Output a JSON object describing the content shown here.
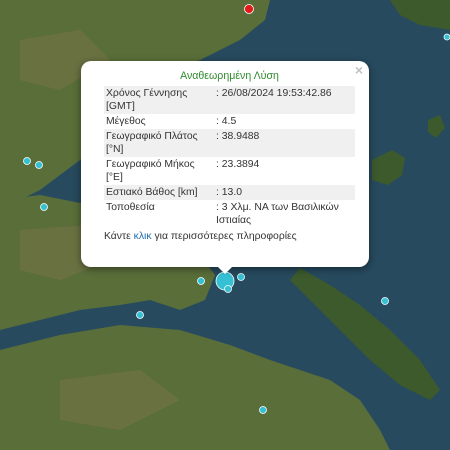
{
  "map": {
    "colors": {
      "sea_deep": "#1f3b50",
      "sea": "#274a5e",
      "land_dark": "#3c5a2c",
      "land": "#5a6e3a",
      "land_brown": "#8a7850",
      "marker_fill": "#35c0d4",
      "marker_stroke": "#ffffff",
      "highlight_marker": "#e41a1a"
    }
  },
  "popup": {
    "close_label": "×",
    "title": "Αναθεωρημένη Λύση",
    "rows": [
      {
        "label": "Χρόνος Γέννησης [GMT]",
        "value": ": 26/08/2024 19:53:42.86"
      },
      {
        "label": "Μέγεθος",
        "value": ": 4.5"
      },
      {
        "label": "Γεωγραφικό Πλάτος [°N]",
        "value": ": 38.9488"
      },
      {
        "label": "Γεωγραφικό Μήκος [°E]",
        "value": ": 23.3894"
      },
      {
        "label": "Εστιακό Βάθος [km]",
        "value": ": 13.0"
      },
      {
        "label": "Τοποθεσία",
        "value": ": 3 Χλμ. ΝΑ των Βασιλικών Ιστιαίας"
      }
    ],
    "info_prefix": "Κάντε",
    "info_link": "κλικ",
    "info_suffix": "για περισσότερες πληροφορίες"
  }
}
